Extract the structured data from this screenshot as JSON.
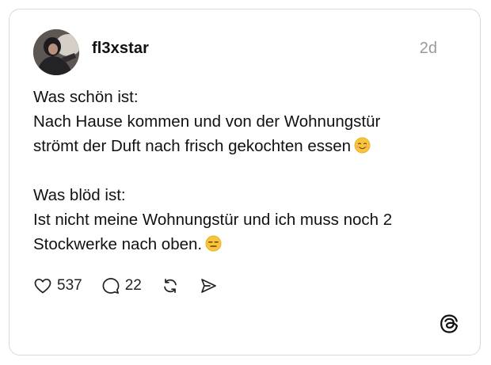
{
  "post": {
    "username": "fl3xstar",
    "time": "2d",
    "lines": [
      "Was schön ist:",
      "Nach Hause kommen und von der Wohnungstür",
      "strömt der Duft nach frisch gekochten essen",
      "",
      "Was blöd ist:",
      "Ist nicht meine Wohnungstür und ich muss noch 2",
      "Stockwerke nach oben."
    ],
    "emojis": {
      "line3": "smiling-face-with-blush",
      "line7": "expressionless-face"
    }
  },
  "actions": {
    "likes": "537",
    "replies": "22"
  },
  "icons": {
    "like": "heart-icon",
    "reply": "speech-bubble-icon",
    "repost": "repost-icon",
    "share": "send-icon",
    "brand": "threads-logo-icon"
  },
  "colors": {
    "border": "#d9d9d9",
    "muted": "#9a9a9a",
    "text": "#111111",
    "emoji": "#f7c43a"
  }
}
